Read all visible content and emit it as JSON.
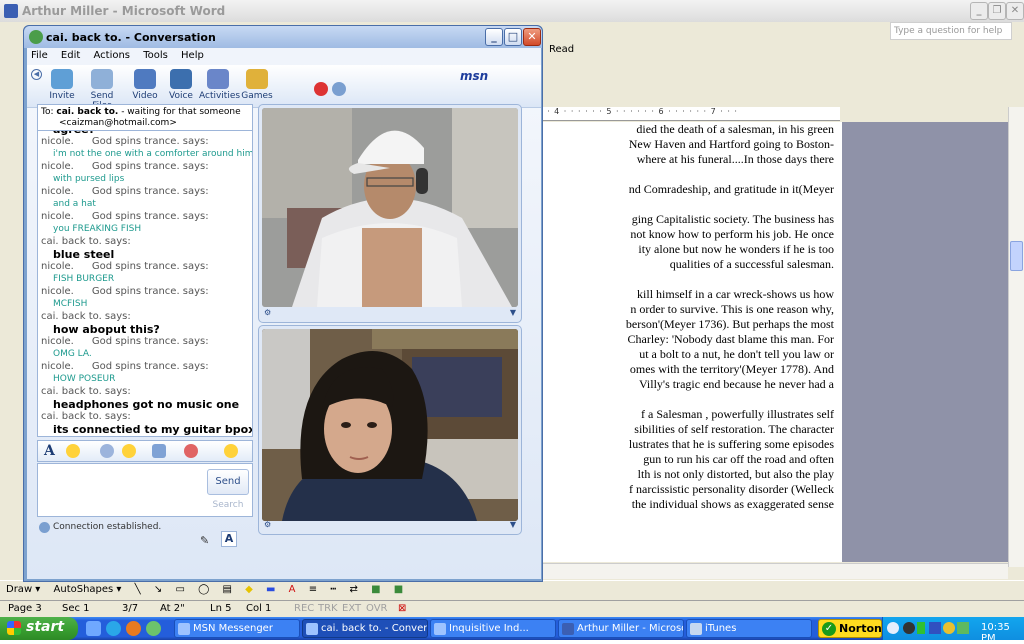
{
  "word": {
    "title": "Arthur Miller - Microsoft Word",
    "ask_placeholder": "Type a question for help",
    "read_label": "Read",
    "ruler": "· · 4 · · · · · · 5 · · · · · · 6 · · · · · · 7 · · ·",
    "doc_lines": [
      "died the death of a salesman, in his green",
      "New Haven and Hartford going to Boston-",
      "where at his funeral....In those days there",
      "",
      "nd Comradeship, and gratitude in it(Meyer",
      "",
      "ging Capitalistic society. The business has",
      "not know how to perform his job. He once",
      "ity alone but now he wonders if he is too",
      "qualities of a successful salesman.",
      "",
      "kill himself in a car wreck-shows us how",
      "n order to survive. This is one reason why,",
      "berson'(Meyer 1736). But perhaps the most",
      "Charley: 'Nobody dast blame this man. For",
      "ut a bolt to a nut, he don't tell you law or",
      "omes with the territory'(Meyer 1778). And",
      "Villy's tragic end because he never had a",
      "",
      "f a Salesman , powerfully illustrates self",
      "sibilities of self restoration. The character",
      "lustrates that he is suffering some episodes",
      "gun to run his car off the road and often",
      "lth is not only distorted, but also the play",
      "f narcissistic personality disorder (Welleck",
      "the individual shows as exaggerated sense"
    ],
    "drawbar": {
      "draw_label": "Draw ▾",
      "autoshapes_label": "AutoShapes ▾"
    },
    "status": {
      "page": "Page 3",
      "sec": "Sec 1",
      "pages": "3/7",
      "at": "At 2\"",
      "ln": "Ln 5",
      "col": "Col 1",
      "rec": "REC",
      "trk": "TRK",
      "ext": "EXT",
      "ovr": "OVR"
    }
  },
  "msn": {
    "title": "cai. back to. - Conversation",
    "menu": [
      "File",
      "Edit",
      "Actions",
      "Tools",
      "Help"
    ],
    "toolbar": [
      "Invite",
      "Send Files",
      "Video",
      "Voice",
      "Activities",
      "Games"
    ],
    "logo": "msn",
    "to_label": "To:",
    "to_name": "cai. back to.",
    "to_status": "- waiting for that someone",
    "to_email": "<caizman@hotmail.com>",
    "messages": [
      {
        "type": "msg",
        "style": "bold",
        "text": "agree?"
      },
      {
        "type": "said",
        "who": "nicole.",
        "name": "God spins trance. says:"
      },
      {
        "type": "msg",
        "style": "teal",
        "text": "i'm not the one with a comforter around him"
      },
      {
        "type": "said",
        "who": "nicole.",
        "name": "God spins trance. says:"
      },
      {
        "type": "msg",
        "style": "teal",
        "text": "with pursed lips"
      },
      {
        "type": "said",
        "who": "nicole.",
        "name": "God spins trance. says:"
      },
      {
        "type": "msg",
        "style": "teal",
        "text": "and a hat"
      },
      {
        "type": "said",
        "who": "nicole.",
        "name": "God spins trance. says:"
      },
      {
        "type": "msg",
        "style": "teal",
        "text": "you FREAKING FISH"
      },
      {
        "type": "said",
        "who": "cai. back to. says:",
        "name": ""
      },
      {
        "type": "msg",
        "style": "bold",
        "text": "blue steel"
      },
      {
        "type": "said",
        "who": "nicole.",
        "name": "God spins trance. says:"
      },
      {
        "type": "msg",
        "style": "teal",
        "text": "FISH BURGER"
      },
      {
        "type": "said",
        "who": "nicole.",
        "name": "God spins trance. says:"
      },
      {
        "type": "msg",
        "style": "teal",
        "text": "MCFISH"
      },
      {
        "type": "said",
        "who": "cai. back to. says:",
        "name": ""
      },
      {
        "type": "msg",
        "style": "bold",
        "text": "how aboput this?"
      },
      {
        "type": "said",
        "who": "nicole.",
        "name": "God spins trance. says:"
      },
      {
        "type": "msg",
        "style": "teal",
        "text": "OMG LA."
      },
      {
        "type": "said",
        "who": "nicole.",
        "name": "God spins trance. says:"
      },
      {
        "type": "msg",
        "style": "teal",
        "text": "HOW POSEUR"
      },
      {
        "type": "said",
        "who": "cai. back to. says:",
        "name": ""
      },
      {
        "type": "msg",
        "style": "bold",
        "text": "headphones got no music one"
      },
      {
        "type": "said",
        "who": "cai. back to. says:",
        "name": ""
      },
      {
        "type": "msg",
        "style": "bold",
        "text": "its connectied to my guitar bpox"
      }
    ],
    "send_label": "Send",
    "search_label": "Search",
    "status_text": "Connection established."
  },
  "taskbar": {
    "start_label": "start",
    "tasks": [
      {
        "label": "MSN Messenger",
        "active": false
      },
      {
        "label": "cai. back to. - Conver...",
        "active": true
      },
      {
        "label": "Inquisitive          Ind...",
        "active": false
      },
      {
        "label": "Arthur Miller - Microso...",
        "active": false
      },
      {
        "label": "iTunes",
        "active": false
      }
    ],
    "norton_label": "Norton",
    "clock": "10:35 PM"
  }
}
